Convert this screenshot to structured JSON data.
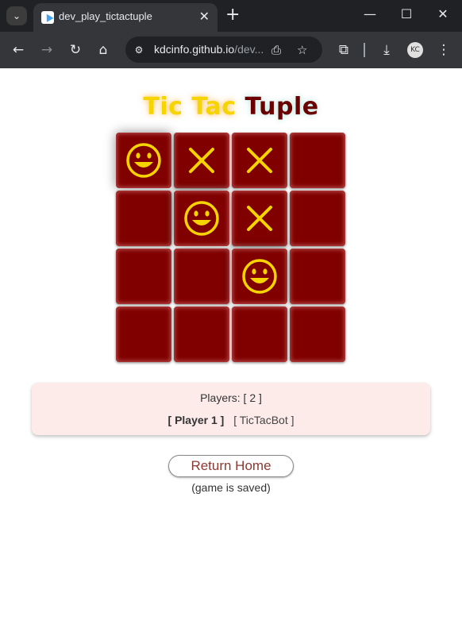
{
  "browser": {
    "tab_title": "dev_play_tictactuple",
    "url_host": "kdcinfo.github.io",
    "url_path": "/dev...",
    "profile_initials": "KC"
  },
  "game": {
    "title_part1": "Tic Tac ",
    "title_part2": "Tuple",
    "board": [
      [
        "smiley",
        "x",
        "x",
        ""
      ],
      [
        "",
        "smiley",
        "x",
        ""
      ],
      [
        "",
        "",
        "smiley",
        ""
      ],
      [
        "",
        "",
        "",
        ""
      ]
    ],
    "colors": {
      "cell": "#800000",
      "mark": "#f5d400"
    }
  },
  "info": {
    "players_label": "Players: [ 2 ]",
    "player1": "[ Player 1 ]",
    "player2": "[ TicTacBot ]"
  },
  "actions": {
    "home_label": "Return Home",
    "saved_note": "(game is saved)"
  }
}
